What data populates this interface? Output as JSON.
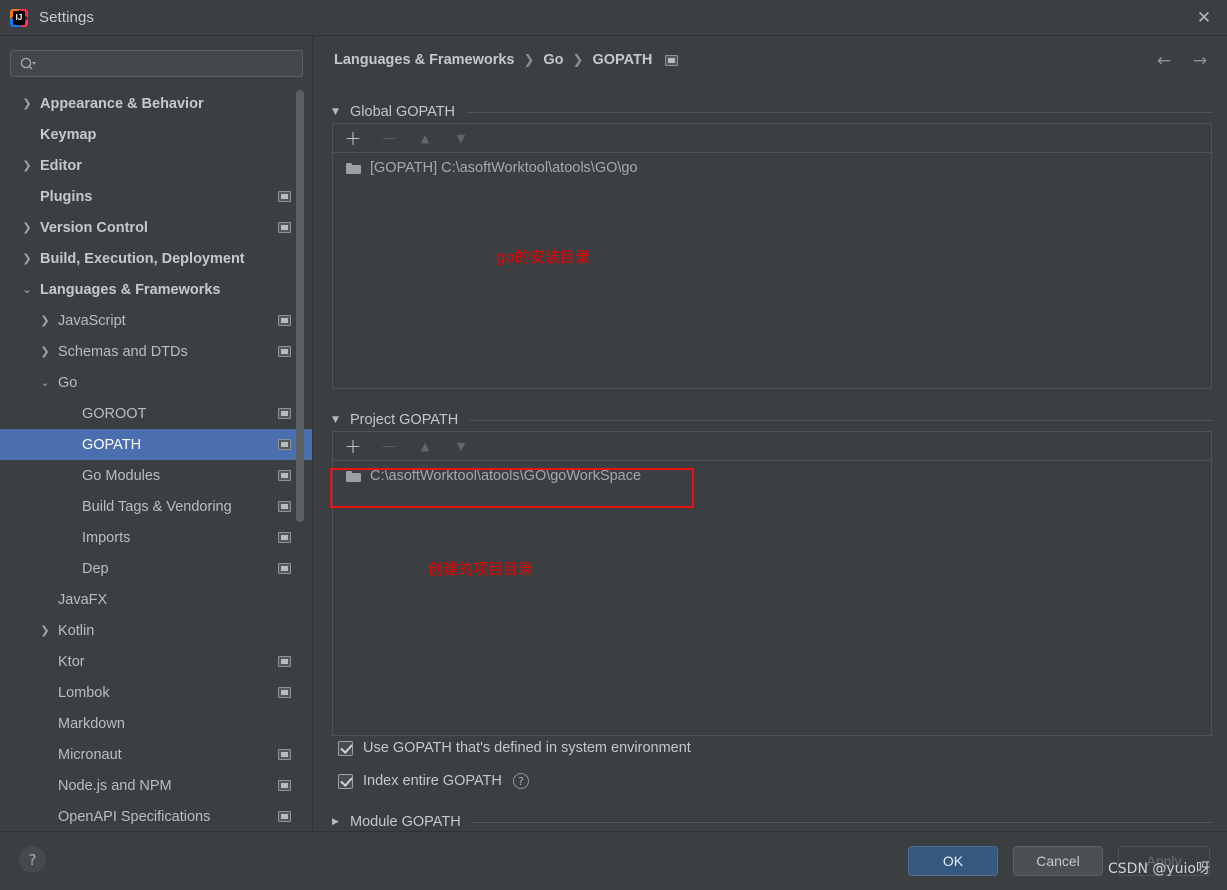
{
  "window": {
    "title": "Settings",
    "logo_text": "IJ",
    "close_icon": "✕"
  },
  "sidebar": {
    "search": {
      "value": "",
      "placeholder": "",
      "icon": "search-icon"
    },
    "items": [
      {
        "label": "Appearance & Behavior",
        "arrow": "❯",
        "level": 0,
        "top": true,
        "badge": false,
        "selected": false
      },
      {
        "label": "Keymap",
        "arrow": "",
        "level": 0,
        "top": true,
        "badge": false,
        "selected": false
      },
      {
        "label": "Editor",
        "arrow": "❯",
        "level": 0,
        "top": true,
        "badge": false,
        "selected": false
      },
      {
        "label": "Plugins",
        "arrow": "",
        "level": 0,
        "top": true,
        "badge": true,
        "selected": false
      },
      {
        "label": "Version Control",
        "arrow": "❯",
        "level": 0,
        "top": true,
        "badge": true,
        "selected": false
      },
      {
        "label": "Build, Execution, Deployment",
        "arrow": "❯",
        "level": 0,
        "top": true,
        "badge": false,
        "selected": false
      },
      {
        "label": "Languages & Frameworks",
        "arrow": "⌄",
        "level": 0,
        "top": true,
        "badge": false,
        "selected": false
      },
      {
        "label": "JavaScript",
        "arrow": "❯",
        "level": 1,
        "top": false,
        "badge": true,
        "selected": false
      },
      {
        "label": "Schemas and DTDs",
        "arrow": "❯",
        "level": 1,
        "top": false,
        "badge": true,
        "selected": false
      },
      {
        "label": "Go",
        "arrow": "⌄",
        "level": 1,
        "top": false,
        "badge": false,
        "selected": false
      },
      {
        "label": "GOROOT",
        "arrow": "",
        "level": 2,
        "top": false,
        "badge": true,
        "selected": false
      },
      {
        "label": "GOPATH",
        "arrow": "",
        "level": 2,
        "top": false,
        "badge": true,
        "selected": true
      },
      {
        "label": "Go Modules",
        "arrow": "",
        "level": 2,
        "top": false,
        "badge": true,
        "selected": false
      },
      {
        "label": "Build Tags & Vendoring",
        "arrow": "",
        "level": 2,
        "top": false,
        "badge": true,
        "selected": false
      },
      {
        "label": "Imports",
        "arrow": "",
        "level": 2,
        "top": false,
        "badge": true,
        "selected": false
      },
      {
        "label": "Dep",
        "arrow": "",
        "level": 2,
        "top": false,
        "badge": true,
        "selected": false
      },
      {
        "label": "JavaFX",
        "arrow": "",
        "level": 1,
        "top": false,
        "badge": false,
        "selected": false
      },
      {
        "label": "Kotlin",
        "arrow": "❯",
        "level": 1,
        "top": false,
        "badge": false,
        "selected": false
      },
      {
        "label": "Ktor",
        "arrow": "",
        "level": 1,
        "top": false,
        "badge": true,
        "selected": false
      },
      {
        "label": "Lombok",
        "arrow": "",
        "level": 1,
        "top": false,
        "badge": true,
        "selected": false
      },
      {
        "label": "Markdown",
        "arrow": "",
        "level": 1,
        "top": false,
        "badge": false,
        "selected": false
      },
      {
        "label": "Micronaut",
        "arrow": "",
        "level": 1,
        "top": false,
        "badge": true,
        "selected": false
      },
      {
        "label": "Node.js and NPM",
        "arrow": "",
        "level": 1,
        "top": false,
        "badge": true,
        "selected": false
      },
      {
        "label": "OpenAPI Specifications",
        "arrow": "",
        "level": 1,
        "top": false,
        "badge": true,
        "selected": false
      }
    ]
  },
  "breadcrumb": {
    "items": [
      "Languages & Frameworks",
      "Go",
      "GOPATH"
    ],
    "separator": "❯",
    "badge": "project-scope-badge"
  },
  "nav": {
    "back": "←",
    "forward": "→"
  },
  "sections": {
    "global": {
      "title": "Global GOPATH",
      "expanded": true,
      "triangle": "▼",
      "toolbar": {
        "add": "+",
        "remove": "−",
        "move_up": "▲",
        "move_down": "▼"
      },
      "rows": [
        {
          "text": "[GOPATH] C:\\asoftWorktool\\atools\\GO\\go",
          "icon": "folder-icon"
        }
      ],
      "annotation": "go的安装目录"
    },
    "project": {
      "title": "Project GOPATH",
      "expanded": true,
      "triangle": "▼",
      "toolbar": {
        "add": "+",
        "remove": "−",
        "move_up": "▲",
        "move_down": "▼"
      },
      "rows": [
        {
          "text": "C:\\asoftWorktool\\atools\\GO\\goWorkSpace",
          "icon": "folder-icon"
        }
      ],
      "annotation": "创建的项目目录",
      "highlight_color": "#ee1111"
    },
    "module": {
      "title": "Module GOPATH",
      "expanded": false,
      "triangle": "▶"
    }
  },
  "checkboxes": [
    {
      "label": "Use GOPATH that's defined in system environment",
      "checked": true,
      "help": false
    },
    {
      "label": "Index entire GOPATH",
      "checked": true,
      "help": true,
      "help_glyph": "?"
    }
  ],
  "footer": {
    "help_glyph": "?",
    "ok": "OK",
    "cancel": "Cancel",
    "apply": "Apply",
    "apply_disabled": true
  },
  "watermark": "CSDN @yuio呀",
  "colors": {
    "background": "#3c3f41",
    "selection": "#4b6eaf",
    "accent_button": "#365880",
    "annotation_red": "#ee0000"
  }
}
